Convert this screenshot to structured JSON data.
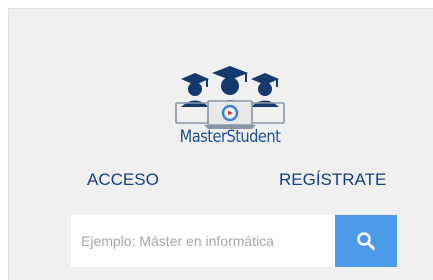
{
  "brand": {
    "name": "MasterStudent"
  },
  "nav": {
    "login_label": "ACCESO",
    "register_label": "REGÍSTRATE"
  },
  "search": {
    "placeholder": "Ejemplo: Máster en informática",
    "value": "",
    "button_icon": "search-icon"
  },
  "colors": {
    "panel_background": "#f0f0f0",
    "brand_blue": "#1c4f92",
    "link_blue": "#153f86",
    "search_button": "#4d9ae9",
    "placeholder": "#a7a7a7"
  }
}
